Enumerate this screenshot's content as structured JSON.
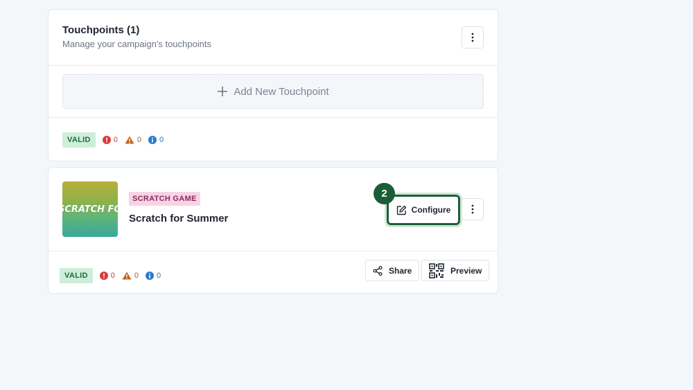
{
  "touchpoints_card": {
    "title": "Touchpoints (1)",
    "subtitle": "Manage your campaign's touchpoints",
    "more_icon": "kebab-vertical-icon",
    "add_label": "Add New Touchpoint",
    "add_icon": "plus-icon",
    "status": {
      "label": "VALID",
      "errors": "0",
      "warnings": "0",
      "infos": "0"
    }
  },
  "touchpoint": {
    "thumbnail_text": "SCRATCH FOR SUMMER",
    "type_label": "SCRATCH GAME",
    "name": "Scratch for Summer",
    "configure_label": "Configure",
    "configure_icon": "edit-icon",
    "step_number": "2",
    "status": {
      "label": "VALID",
      "errors": "0",
      "warnings": "0",
      "infos": "0"
    },
    "share_label": "Share",
    "share_icon": "share-icon",
    "preview_label": "Preview",
    "preview_icon": "qr-code-icon"
  },
  "colors": {
    "page_bg": "#f4f7fa",
    "valid_badge_bg": "#cdeed9",
    "valid_badge_text": "#1d6b3a",
    "type_badge_bg": "#f8d3e6",
    "type_badge_text": "#8a2a5c",
    "accent_green": "#1a5e37",
    "error": "#d93a3a",
    "warning": "#c1651d",
    "info": "#2a7bc8"
  }
}
